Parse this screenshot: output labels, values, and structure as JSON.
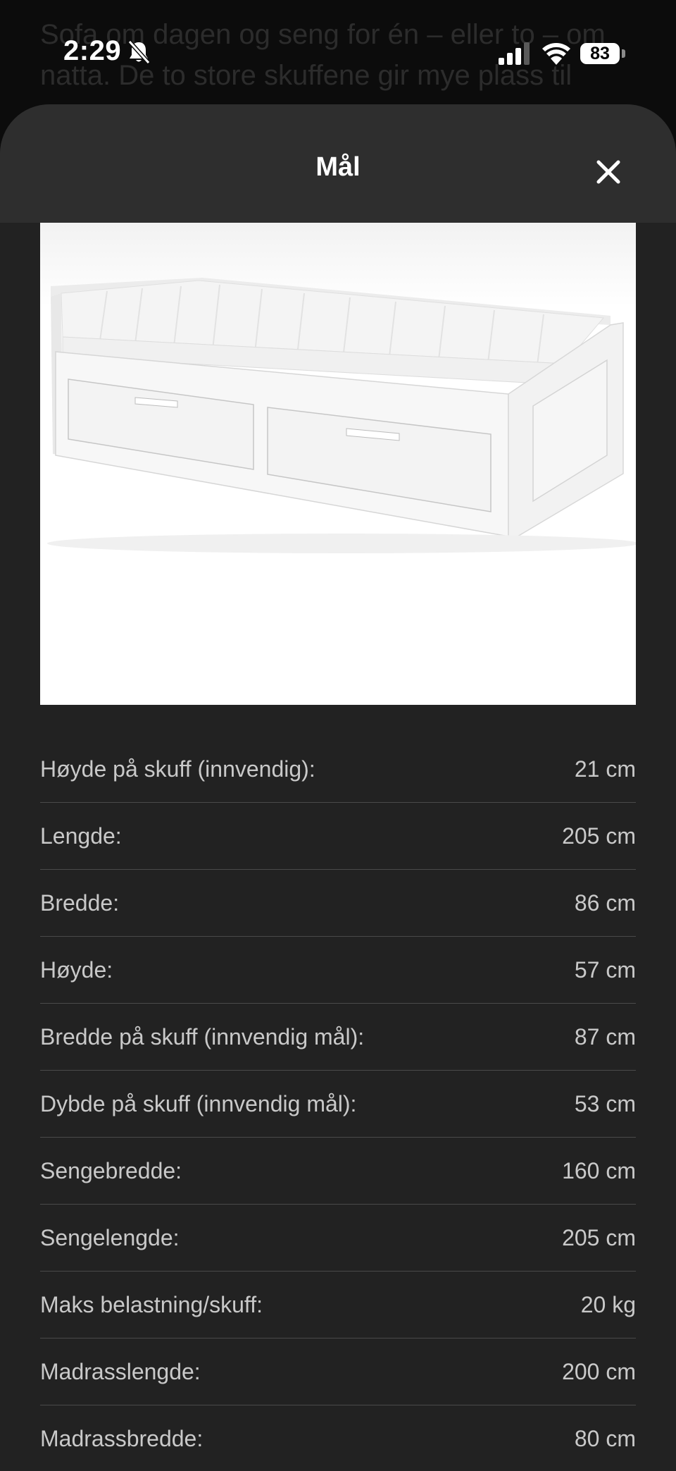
{
  "background_page": {
    "text": "Sofa om dagen og seng for én – eller to – om\nnatta. De to store skuffene gir mye plass til"
  },
  "status_bar": {
    "time": "2:29",
    "battery": "83",
    "icons": [
      "bell-slash-icon",
      "cellular-signal-icon",
      "wifi-icon",
      "battery-icon"
    ]
  },
  "sheet": {
    "title": "Mål",
    "close_icon": "close-icon"
  },
  "product_image": {
    "description_icon": "daybed-illustration"
  },
  "dimensions": [
    {
      "label": "Høyde på skuff (innvendig):",
      "value": "21 cm"
    },
    {
      "label": "Lengde:",
      "value": "205 cm"
    },
    {
      "label": "Bredde:",
      "value": "86 cm"
    },
    {
      "label": "Høyde:",
      "value": "57 cm"
    },
    {
      "label": "Bredde på skuff (innvendig mål):",
      "value": "87 cm"
    },
    {
      "label": "Dybde på skuff (innvendig mål):",
      "value": "53 cm"
    },
    {
      "label": "Sengebredde:",
      "value": "160 cm"
    },
    {
      "label": "Sengelengde:",
      "value": "205 cm"
    },
    {
      "label": "Maks belastning/skuff:",
      "value": "20 kg"
    },
    {
      "label": "Madrasslengde:",
      "value": "200 cm"
    },
    {
      "label": "Madrassbredde:",
      "value": "80 cm"
    }
  ],
  "colors": {
    "sheet_background": "#222222",
    "header_background": "#2e2e2e",
    "text_primary": "#ffffff",
    "text_secondary": "#c9c9c9",
    "divider": "#4a4a4a"
  }
}
